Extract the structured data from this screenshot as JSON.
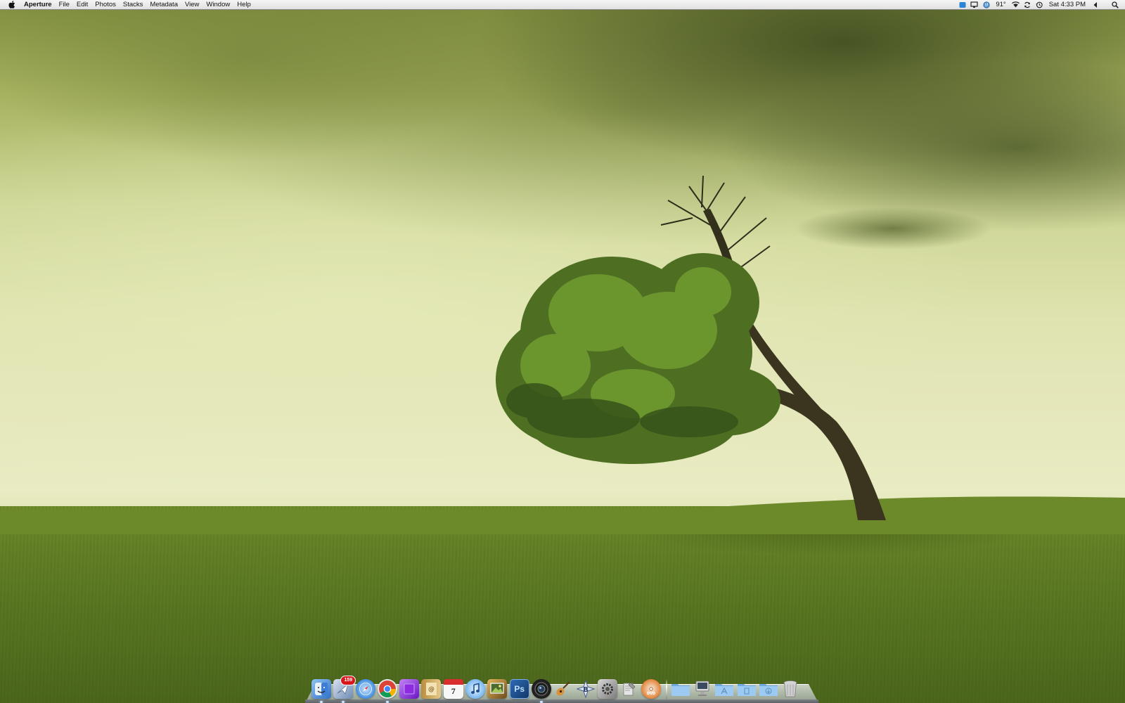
{
  "menubar": {
    "apple_icon": "apple-logo-icon",
    "app_name": "Aperture",
    "menus": [
      "File",
      "Edit",
      "Photos",
      "Stacks",
      "Metadata",
      "View",
      "Window",
      "Help"
    ],
    "status": {
      "temperature": "91°",
      "clock": "Sat 4:33 PM",
      "icons": [
        "dropbox-icon",
        "display-icon",
        "globe-icon",
        "wifi-icon",
        "sync-icon",
        "time-machine-icon",
        "volume-icon",
        "spotlight-icon"
      ]
    }
  },
  "dock": {
    "apps": [
      {
        "name": "finder",
        "icon": "finder-icon",
        "color": "#4a8de0",
        "running": true
      },
      {
        "name": "mail",
        "icon": "mail-icon",
        "color": "#8aa4c9",
        "badge": "159",
        "running": true
      },
      {
        "name": "safari",
        "icon": "safari-icon",
        "color": "#3f8de0",
        "running": false
      },
      {
        "name": "chrome",
        "icon": "chrome-icon",
        "color": "#e8e8e8",
        "running": true
      },
      {
        "name": "purple-app",
        "icon": "purple-app-icon",
        "color": "#8a2bd6",
        "running": false
      },
      {
        "name": "address-book",
        "icon": "address-book-icon",
        "color": "#d8b46a",
        "running": false
      },
      {
        "name": "ical",
        "icon": "calendar-icon",
        "color": "#f5f5f5",
        "day": "7",
        "running": false
      },
      {
        "name": "itunes",
        "icon": "itunes-icon",
        "color": "#5fa8e8",
        "running": false
      },
      {
        "name": "iphoto",
        "icon": "iphoto-icon",
        "color": "#4d6b2f",
        "running": false
      },
      {
        "name": "photoshop",
        "icon": "photoshop-icon",
        "color": "#1f4f8c",
        "label": "Ps",
        "running": false
      },
      {
        "name": "aperture",
        "icon": "aperture-icon",
        "color": "#2b2b2b",
        "running": true
      },
      {
        "name": "garageband",
        "icon": "guitar-icon",
        "color": "#c88a3a",
        "running": false
      },
      {
        "name": "bbedit",
        "icon": "bbedit-icon",
        "color": "#dfe6f2",
        "running": false
      },
      {
        "name": "system-preferences",
        "icon": "gear-icon",
        "color": "#9a9a9a",
        "running": false
      },
      {
        "name": "script-editor",
        "icon": "script-icon",
        "color": "#c0c0c0",
        "running": false
      },
      {
        "name": "dvd-player",
        "icon": "dvd-icon",
        "color": "#e07a2a",
        "running": false
      }
    ],
    "stacks": [
      {
        "name": "folder",
        "icon": "folder-icon",
        "color": "#8cc1ec"
      },
      {
        "name": "computer",
        "icon": "computer-icon",
        "color": "#b8b8b8"
      },
      {
        "name": "applications",
        "icon": "applications-folder-icon",
        "color": "#8cc1ec"
      },
      {
        "name": "documents",
        "icon": "documents-folder-icon",
        "color": "#8cc1ec"
      },
      {
        "name": "downloads",
        "icon": "downloads-folder-icon",
        "color": "#8cc1ec"
      },
      {
        "name": "trash",
        "icon": "trash-icon",
        "color": "#c8c8c8"
      }
    ]
  }
}
